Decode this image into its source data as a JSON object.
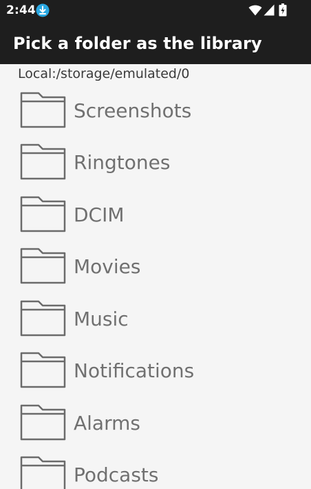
{
  "status_bar": {
    "time": "2:44",
    "icons": [
      "download-icon",
      "wifi-icon",
      "signal-icon",
      "battery-charging-icon"
    ]
  },
  "app_bar": {
    "title": "Pick a folder as the library"
  },
  "path": "Local:/storage/emulated/0",
  "folders": [
    {
      "name": "Screenshots",
      "icon": "folder-icon"
    },
    {
      "name": "Ringtones",
      "icon": "folder-icon"
    },
    {
      "name": "DCIM",
      "icon": "folder-icon"
    },
    {
      "name": "Movies",
      "icon": "folder-icon"
    },
    {
      "name": "Music",
      "icon": "folder-icon"
    },
    {
      "name": "Notifications",
      "icon": "folder-icon"
    },
    {
      "name": "Alarms",
      "icon": "folder-icon"
    },
    {
      "name": "Podcasts",
      "icon": "folder-icon"
    }
  ],
  "colors": {
    "bar_background": "#1e1e1e",
    "page_background": "#f5f5f5",
    "folder_text": "#707070",
    "accent": "#29a7e1"
  }
}
